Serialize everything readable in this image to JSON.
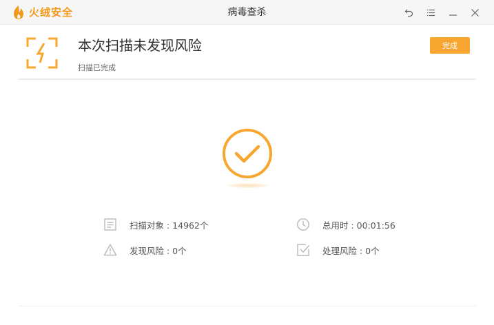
{
  "app": {
    "brand": "火绒安全",
    "window_title": "病毒查杀"
  },
  "header": {
    "title": "本次扫描未发现风险",
    "subtitle": "扫描已完成",
    "done_label": "完成"
  },
  "stats": {
    "scanned_label": "扫描对象 : 14962个",
    "total_time_label": "总用时 : 00:01:56",
    "found_risk_label": "发现风险 : 0个",
    "handled_risk_label": "处理风险 : 0个"
  },
  "colors": {
    "accent": "#f7a72f",
    "brand": "#f29a1d",
    "icon_gray": "#b9b9b9"
  },
  "icons": {
    "brand_logo": "flame-shield-icon",
    "back": "back-arrow-icon",
    "menu": "menu-icon",
    "minimize": "minimize-icon",
    "close": "close-icon",
    "scan": "scan-bolt-icon",
    "success": "check-circle-icon",
    "scanned": "document-icon",
    "time": "clock-icon",
    "risk": "warning-icon",
    "handled": "checkbox-icon"
  }
}
